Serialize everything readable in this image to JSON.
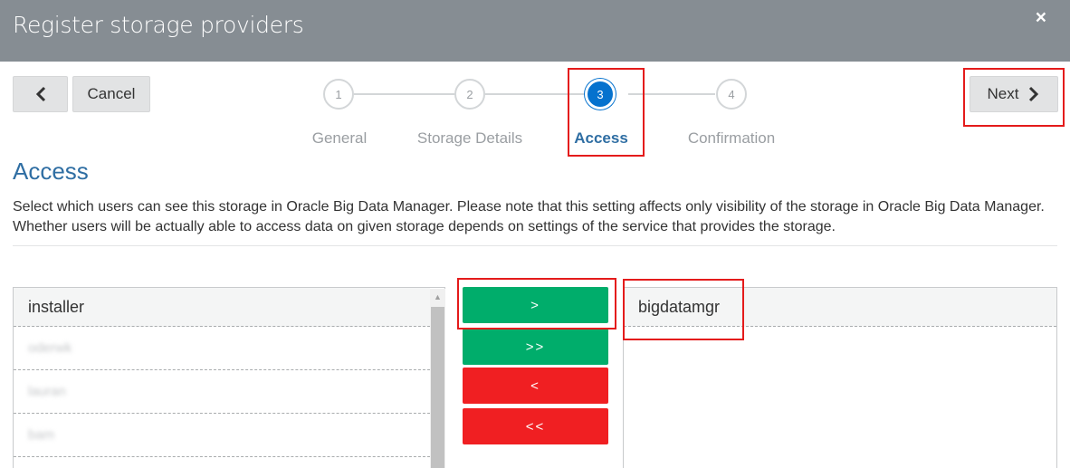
{
  "dialog": {
    "title": "Register storage providers",
    "close_symbol": "×"
  },
  "toolbar": {
    "back_icon": "chevron-left-icon",
    "cancel_label": "Cancel",
    "next_label": "Next",
    "next_icon": "chevron-right-icon"
  },
  "steps": [
    {
      "number": "1",
      "label": "General",
      "active": false
    },
    {
      "number": "2",
      "label": "Storage Details",
      "active": false
    },
    {
      "number": "3",
      "label": "Access",
      "active": true
    },
    {
      "number": "4",
      "label": "Confirmation",
      "active": false
    }
  ],
  "section": {
    "title": "Access",
    "description": "Select which users can see this storage in Oracle Big Data Manager. Please note that this setting affects only visibility of the storage in Oracle Big Data Manager. Whether users will be actually able to access data on given storage depends on settings of the service that provides the storage."
  },
  "available_users": [
    "installer",
    "oderwk",
    "lauran",
    "bam"
  ],
  "selected_users": [
    "bigdatamgr"
  ],
  "move_buttons": {
    "add_one": ">",
    "add_all": ">>",
    "remove_one": "<",
    "remove_all": "<<"
  },
  "colors": {
    "titlebar": "#868d93",
    "accent": "#0572ce",
    "add": "#00ad6b",
    "remove": "#f01f22",
    "highlight": "#e41b1b"
  }
}
